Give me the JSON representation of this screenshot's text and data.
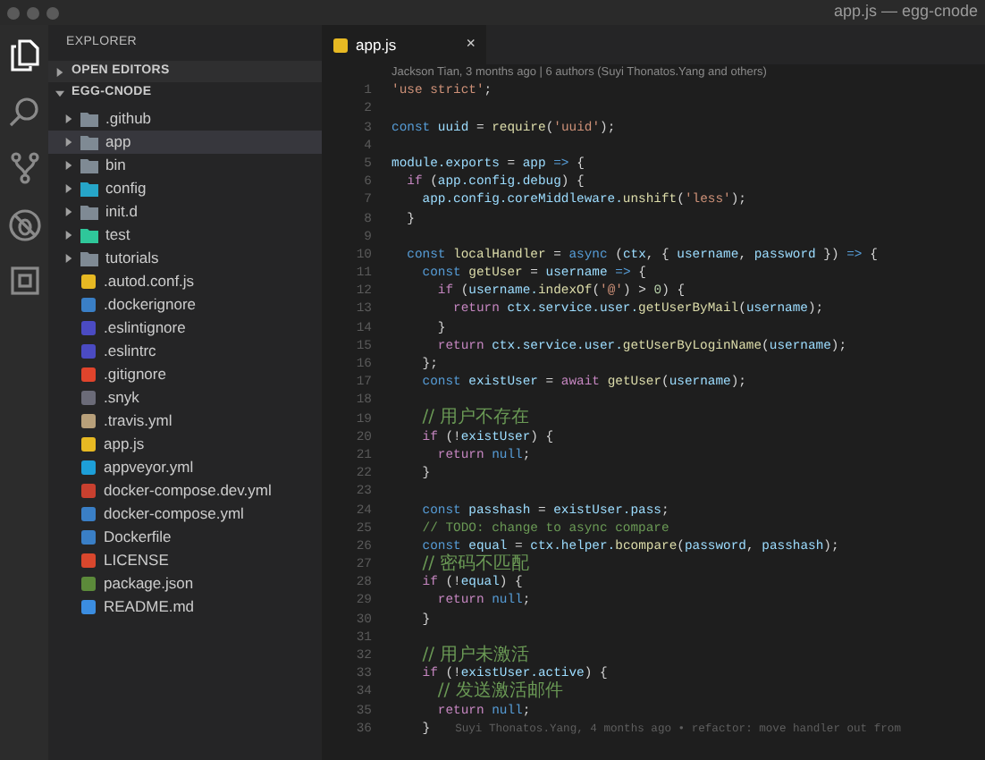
{
  "window": {
    "title": "app.js — egg-cnode"
  },
  "activity_bar": [
    {
      "kind": "files",
      "selected": true
    },
    {
      "kind": "search",
      "selected": false
    },
    {
      "kind": "source-control",
      "selected": false
    },
    {
      "kind": "debug",
      "selected": false
    },
    {
      "kind": "extensions",
      "selected": false
    }
  ],
  "sidebar": {
    "title": "EXPLORER",
    "sections": [
      {
        "label": "OPEN EDITORS",
        "expanded": false
      },
      {
        "label": "EGG-CNODE",
        "expanded": true
      }
    ],
    "items": [
      {
        "name": ".github",
        "kind": "folder",
        "color": "#7f8a94",
        "selected": false
      },
      {
        "name": "app",
        "kind": "folder",
        "color": "#7f8a94",
        "selected": true
      },
      {
        "name": "bin",
        "kind": "folder",
        "color": "#7f8a94",
        "selected": false
      },
      {
        "name": "config",
        "kind": "folder",
        "color": "#26a5c8",
        "selected": false
      },
      {
        "name": "init.d",
        "kind": "folder",
        "color": "#7f8a94",
        "selected": false
      },
      {
        "name": "test",
        "kind": "folder",
        "color": "#2fc79a",
        "selected": false
      },
      {
        "name": "tutorials",
        "kind": "folder",
        "color": "#7f8a94",
        "selected": false
      },
      {
        "name": ".autod.conf.js",
        "kind": "file",
        "color": "#e7b923",
        "selected": false
      },
      {
        "name": ".dockerignore",
        "kind": "file",
        "color": "#3a7fc6",
        "selected": false
      },
      {
        "name": ".eslintignore",
        "kind": "file",
        "color": "#4b4bc3",
        "selected": false
      },
      {
        "name": ".eslintrc",
        "kind": "file",
        "color": "#4b4bc3",
        "selected": false
      },
      {
        "name": ".gitignore",
        "kind": "file",
        "color": "#e0442c",
        "selected": false
      },
      {
        "name": ".snyk",
        "kind": "file",
        "color": "#6b6b78",
        "selected": false
      },
      {
        "name": ".travis.yml",
        "kind": "file",
        "color": "#b8a07a",
        "selected": false
      },
      {
        "name": "app.js",
        "kind": "file",
        "color": "#e7b923",
        "selected": false
      },
      {
        "name": "appveyor.yml",
        "kind": "file",
        "color": "#1d9fd8",
        "selected": false
      },
      {
        "name": "docker-compose.dev.yml",
        "kind": "file",
        "color": "#c9402f",
        "selected": false
      },
      {
        "name": "docker-compose.yml",
        "kind": "file",
        "color": "#3a7fc6",
        "selected": false
      },
      {
        "name": "Dockerfile",
        "kind": "file",
        "color": "#3a7fc6",
        "selected": false
      },
      {
        "name": "LICENSE",
        "kind": "file",
        "color": "#d9472d",
        "selected": false
      },
      {
        "name": "package.json",
        "kind": "file",
        "color": "#5c8a3a",
        "selected": false
      },
      {
        "name": "README.md",
        "kind": "file",
        "color": "#3b8de0",
        "selected": false
      }
    ]
  },
  "tabs": [
    {
      "label": "app.js",
      "close": "×",
      "selected": true
    }
  ],
  "editor": {
    "blame_header": "Jackson Tian, 3 months ago | 6 authors (Suyi Thonatos.Yang and others)",
    "lines": [
      {
        "number": "1",
        "tokens": [
          {
            "text": "'use strict'",
            "kind": "string"
          },
          {
            "text": ";",
            "kind": "plain"
          }
        ]
      },
      {
        "number": "2"
      },
      {
        "number": "3",
        "tokens": [
          {
            "text": "const",
            "kind": "keyword"
          },
          {
            "text": " uuid",
            "kind": "variable"
          },
          {
            "text": " = ",
            "kind": "plain"
          },
          {
            "text": "require",
            "kind": "function"
          },
          {
            "text": "(",
            "kind": "plain"
          },
          {
            "text": "'uuid'",
            "kind": "string"
          },
          {
            "text": ");",
            "kind": "plain"
          }
        ]
      },
      {
        "number": "4"
      },
      {
        "number": "5",
        "tokens": [
          {
            "text": "module.exports",
            "kind": "variable"
          },
          {
            "text": " = ",
            "kind": "plain"
          },
          {
            "text": "app",
            "kind": "variable"
          },
          {
            "text": " =>",
            "kind": "keyword"
          },
          {
            "text": " {",
            "kind": "plain"
          }
        ]
      },
      {
        "number": "6",
        "tokens": [
          {
            "text": "  if",
            "kind": "control"
          },
          {
            "text": " (",
            "kind": "plain"
          },
          {
            "text": "app.config.debug",
            "kind": "variable"
          },
          {
            "text": ") {",
            "kind": "plain"
          }
        ]
      },
      {
        "number": "7",
        "tokens": [
          {
            "text": "    app.config.coreMiddleware.",
            "kind": "variable"
          },
          {
            "text": "unshift",
            "kind": "function"
          },
          {
            "text": "(",
            "kind": "plain"
          },
          {
            "text": "'less'",
            "kind": "string"
          },
          {
            "text": ");",
            "kind": "plain"
          }
        ]
      },
      {
        "number": "8",
        "tokens": [
          {
            "text": "  }",
            "kind": "plain"
          }
        ]
      },
      {
        "number": "9"
      },
      {
        "number": "10",
        "tokens": [
          {
            "text": "  const",
            "kind": "keyword"
          },
          {
            "text": " localHandler",
            "kind": "function"
          },
          {
            "text": " = ",
            "kind": "plain"
          },
          {
            "text": "async",
            "kind": "keyword"
          },
          {
            "text": " (",
            "kind": "plain"
          },
          {
            "text": "ctx",
            "kind": "variable"
          },
          {
            "text": ", { ",
            "kind": "plain"
          },
          {
            "text": "username",
            "kind": "variable"
          },
          {
            "text": ", ",
            "kind": "plain"
          },
          {
            "text": "password",
            "kind": "variable"
          },
          {
            "text": " }) ",
            "kind": "plain"
          },
          {
            "text": "=>",
            "kind": "keyword"
          },
          {
            "text": " {",
            "kind": "plain"
          }
        ]
      },
      {
        "number": "11",
        "tokens": [
          {
            "text": "    const",
            "kind": "keyword"
          },
          {
            "text": " getUser",
            "kind": "function"
          },
          {
            "text": " = ",
            "kind": "plain"
          },
          {
            "text": "username",
            "kind": "variable"
          },
          {
            "text": " =>",
            "kind": "keyword"
          },
          {
            "text": " {",
            "kind": "plain"
          }
        ]
      },
      {
        "number": "12",
        "tokens": [
          {
            "text": "      if",
            "kind": "control"
          },
          {
            "text": " (",
            "kind": "plain"
          },
          {
            "text": "username.",
            "kind": "variable"
          },
          {
            "text": "indexOf",
            "kind": "function"
          },
          {
            "text": "(",
            "kind": "plain"
          },
          {
            "text": "'@'",
            "kind": "string"
          },
          {
            "text": ") > ",
            "kind": "plain"
          },
          {
            "text": "0",
            "kind": "number"
          },
          {
            "text": ") {",
            "kind": "plain"
          }
        ]
      },
      {
        "number": "13",
        "tokens": [
          {
            "text": "        return",
            "kind": "control"
          },
          {
            "text": " ctx.service.user.",
            "kind": "variable"
          },
          {
            "text": "getUserByMail",
            "kind": "function"
          },
          {
            "text": "(",
            "kind": "plain"
          },
          {
            "text": "username",
            "kind": "variable"
          },
          {
            "text": ");",
            "kind": "plain"
          }
        ]
      },
      {
        "number": "14",
        "tokens": [
          {
            "text": "      }",
            "kind": "plain"
          }
        ]
      },
      {
        "number": "15",
        "tokens": [
          {
            "text": "      return",
            "kind": "control"
          },
          {
            "text": " ctx.service.user.",
            "kind": "variable"
          },
          {
            "text": "getUserByLoginName",
            "kind": "function"
          },
          {
            "text": "(",
            "kind": "plain"
          },
          {
            "text": "username",
            "kind": "variable"
          },
          {
            "text": ");",
            "kind": "plain"
          }
        ]
      },
      {
        "number": "16",
        "tokens": [
          {
            "text": "    };",
            "kind": "plain"
          }
        ]
      },
      {
        "number": "17",
        "tokens": [
          {
            "text": "    const",
            "kind": "keyword"
          },
          {
            "text": " existUser",
            "kind": "variable"
          },
          {
            "text": " = ",
            "kind": "plain"
          },
          {
            "text": "await",
            "kind": "control"
          },
          {
            "text": " getUser",
            "kind": "function"
          },
          {
            "text": "(",
            "kind": "plain"
          },
          {
            "text": "username",
            "kind": "variable"
          },
          {
            "text": ");",
            "kind": "plain"
          }
        ]
      },
      {
        "number": "18"
      },
      {
        "number": "19",
        "tokens": [
          {
            "text": "    // 用户不存在",
            "kind": "comment"
          }
        ]
      },
      {
        "number": "20",
        "tokens": [
          {
            "text": "    if",
            "kind": "control"
          },
          {
            "text": " (!",
            "kind": "plain"
          },
          {
            "text": "existUser",
            "kind": "variable"
          },
          {
            "text": ") {",
            "kind": "plain"
          }
        ]
      },
      {
        "number": "21",
        "tokens": [
          {
            "text": "      return",
            "kind": "control"
          },
          {
            "text": " null",
            "kind": "keyword"
          },
          {
            "text": ";",
            "kind": "plain"
          }
        ]
      },
      {
        "number": "22",
        "tokens": [
          {
            "text": "    }",
            "kind": "plain"
          }
        ]
      },
      {
        "number": "23"
      },
      {
        "number": "24",
        "tokens": [
          {
            "text": "    const",
            "kind": "keyword"
          },
          {
            "text": " passhash",
            "kind": "variable"
          },
          {
            "text": " = ",
            "kind": "plain"
          },
          {
            "text": "existUser.pass",
            "kind": "variable"
          },
          {
            "text": ";",
            "kind": "plain"
          }
        ]
      },
      {
        "number": "25",
        "tokens": [
          {
            "text": "    // TODO: change to async compare",
            "kind": "comment"
          }
        ]
      },
      {
        "number": "26",
        "tokens": [
          {
            "text": "    const",
            "kind": "keyword"
          },
          {
            "text": " equal",
            "kind": "variable"
          },
          {
            "text": " = ",
            "kind": "plain"
          },
          {
            "text": "ctx.helper.",
            "kind": "variable"
          },
          {
            "text": "bcompare",
            "kind": "function"
          },
          {
            "text": "(",
            "kind": "plain"
          },
          {
            "text": "password",
            "kind": "variable"
          },
          {
            "text": ", ",
            "kind": "plain"
          },
          {
            "text": "passhash",
            "kind": "variable"
          },
          {
            "text": ");",
            "kind": "plain"
          }
        ]
      },
      {
        "number": "27",
        "tokens": [
          {
            "text": "    // 密码不匹配",
            "kind": "comment"
          }
        ]
      },
      {
        "number": "28",
        "tokens": [
          {
            "text": "    if",
            "kind": "control"
          },
          {
            "text": " (!",
            "kind": "plain"
          },
          {
            "text": "equal",
            "kind": "variable"
          },
          {
            "text": ") {",
            "kind": "plain"
          }
        ]
      },
      {
        "number": "29",
        "tokens": [
          {
            "text": "      return",
            "kind": "control"
          },
          {
            "text": " null",
            "kind": "keyword"
          },
          {
            "text": ";",
            "kind": "plain"
          }
        ]
      },
      {
        "number": "30",
        "tokens": [
          {
            "text": "    }",
            "kind": "plain"
          }
        ]
      },
      {
        "number": "31"
      },
      {
        "number": "32",
        "tokens": [
          {
            "text": "    // 用户未激活",
            "kind": "comment"
          }
        ]
      },
      {
        "number": "33",
        "tokens": [
          {
            "text": "    if",
            "kind": "control"
          },
          {
            "text": " (!",
            "kind": "plain"
          },
          {
            "text": "existUser.active",
            "kind": "variable"
          },
          {
            "text": ") {",
            "kind": "plain"
          }
        ]
      },
      {
        "number": "34",
        "tokens": [
          {
            "text": "      // 发送激活邮件",
            "kind": "comment"
          }
        ]
      },
      {
        "number": "35",
        "tokens": [
          {
            "text": "      return",
            "kind": "control"
          },
          {
            "text": " null",
            "kind": "keyword"
          },
          {
            "text": ";",
            "kind": "plain"
          }
        ]
      },
      {
        "number": "36",
        "tokens": [
          {
            "text": "    }",
            "kind": "plain"
          }
        ],
        "blame": "Suyi Thonatos.Yang, 4 months ago • refactor: move handler out from"
      }
    ]
  }
}
